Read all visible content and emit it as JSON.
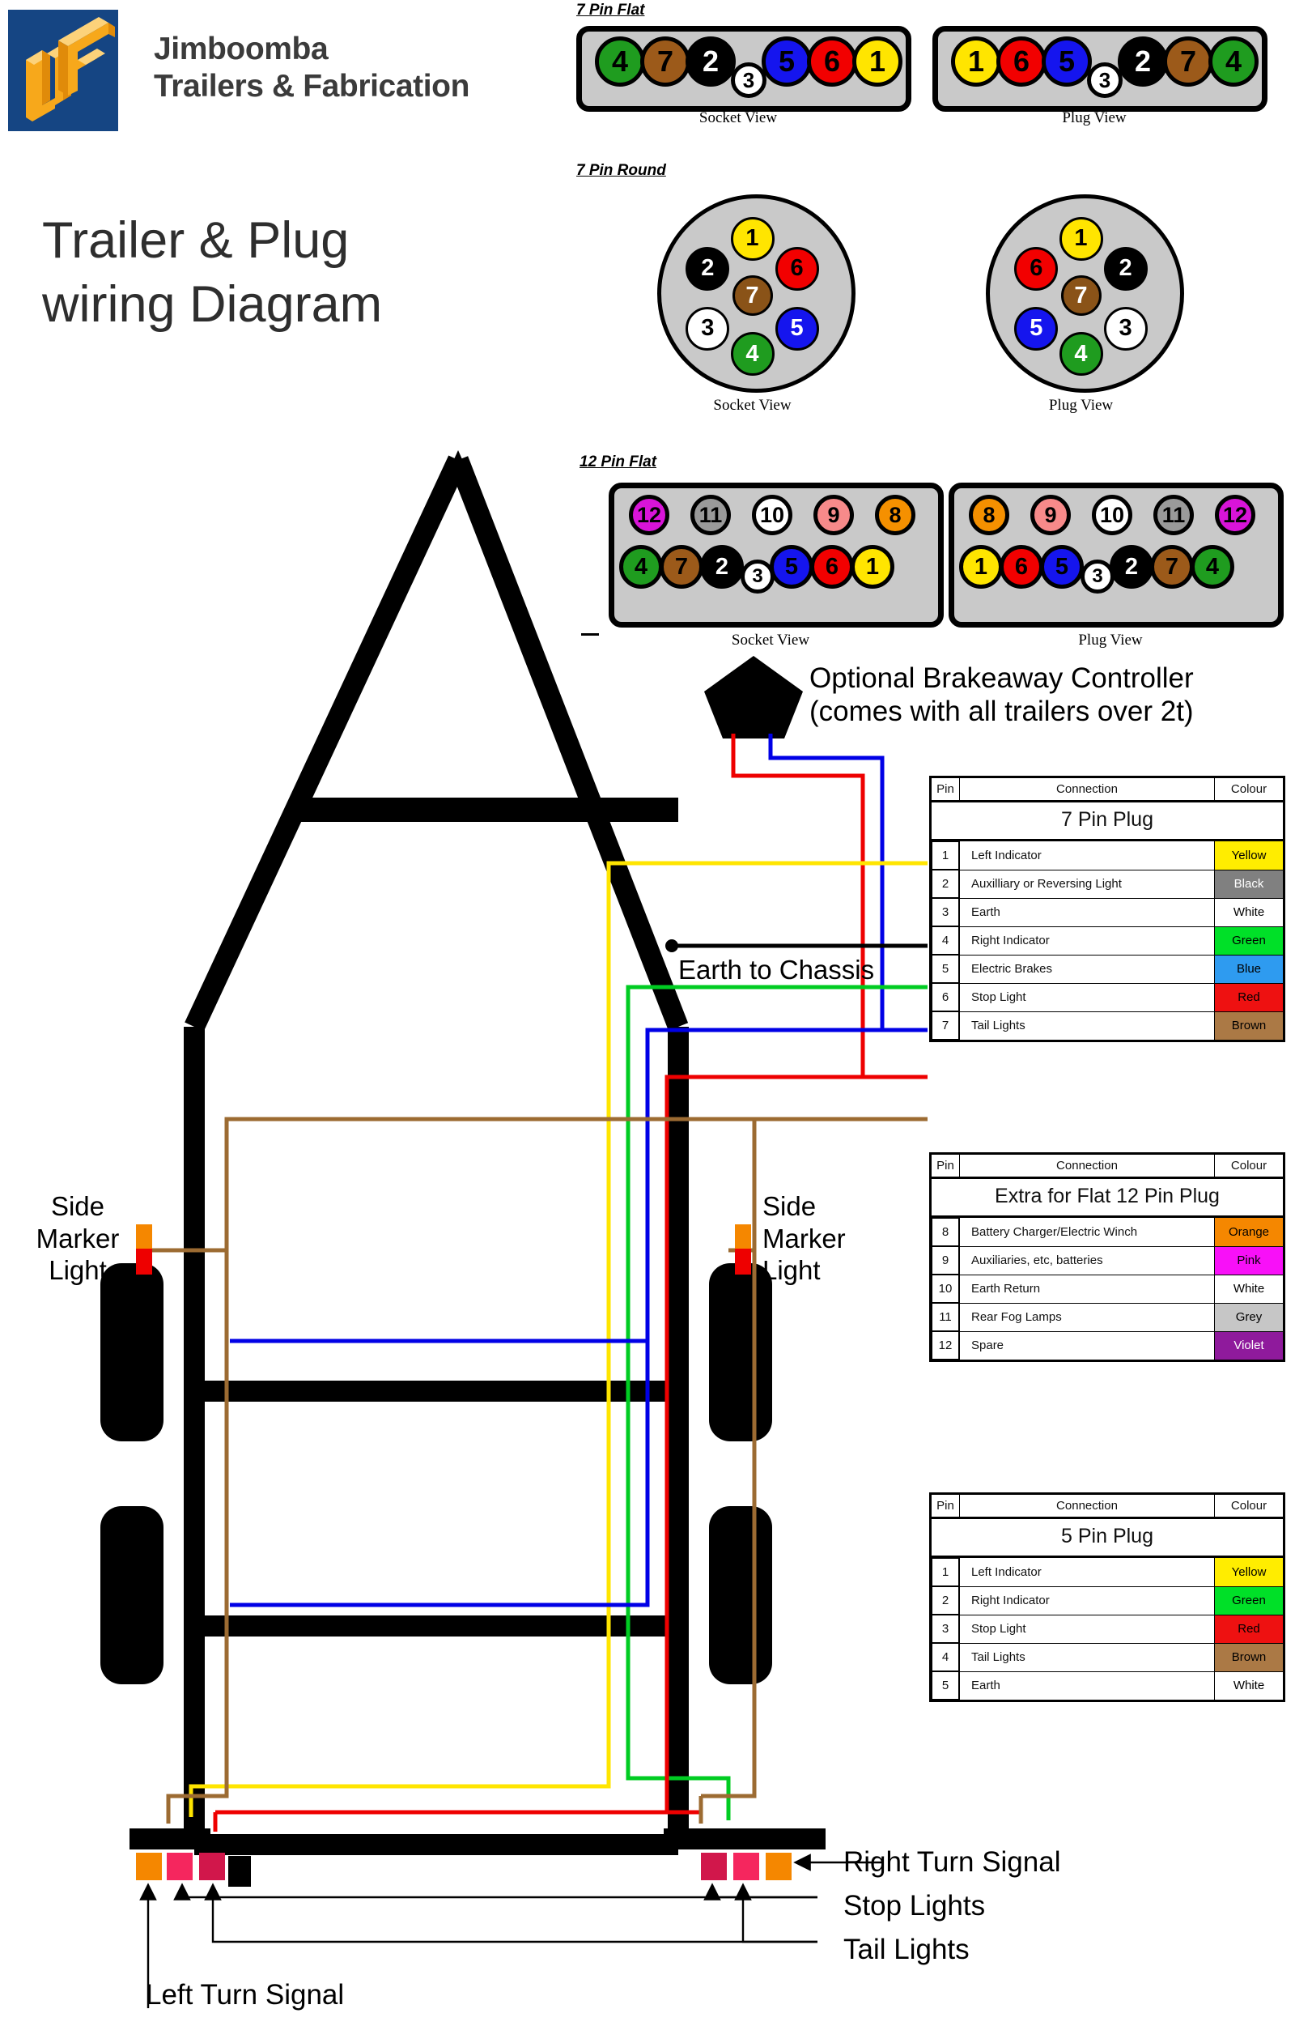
{
  "brand": {
    "name_line1": "Jimboomba",
    "name_line2": "Trailers & Fabrication",
    "logo_text": "JTF",
    "logo_bg": "#154583",
    "logo_fg": "#f5a623"
  },
  "page_title_line1": "Trailer & Plug",
  "page_title_line2": "wiring Diagram",
  "connectors": [
    {
      "heading": "7 Pin Flat",
      "type": "flat7",
      "socket": {
        "view_label": "Socket View",
        "pins": [
          {
            "n": "4",
            "color": "#1f9c1f",
            "text": "#000"
          },
          {
            "n": "7",
            "color": "#9c5a1a",
            "text": "#000"
          },
          {
            "n": "2",
            "color": "#000000",
            "text": "#ffffff"
          },
          {
            "n": "3",
            "color": "#ffffff",
            "text": "#000000",
            "low": true
          },
          {
            "n": "5",
            "color": "#1515ee",
            "text": "#000000"
          },
          {
            "n": "6",
            "color": "#f20000",
            "text": "#000000"
          },
          {
            "n": "1",
            "color": "#ffe500",
            "text": "#000000"
          }
        ]
      },
      "plug": {
        "view_label": "Plug View",
        "pins": [
          {
            "n": "1",
            "color": "#ffe500",
            "text": "#000000"
          },
          {
            "n": "6",
            "color": "#f20000",
            "text": "#000000"
          },
          {
            "n": "5",
            "color": "#1515ee",
            "text": "#000000"
          },
          {
            "n": "3",
            "color": "#ffffff",
            "text": "#000000",
            "low": true
          },
          {
            "n": "2",
            "color": "#000000",
            "text": "#ffffff"
          },
          {
            "n": "7",
            "color": "#9c5a1a",
            "text": "#000000"
          },
          {
            "n": "4",
            "color": "#1f9c1f",
            "text": "#000000"
          }
        ]
      }
    },
    {
      "heading": "7 Pin Round",
      "type": "round7",
      "socket": {
        "view_label": "Socket View",
        "pins": [
          {
            "n": "1",
            "color": "#ffe500",
            "text": "#000000",
            "pos": "top"
          },
          {
            "n": "2",
            "color": "#000000",
            "text": "#ffffff",
            "pos": "upper-left"
          },
          {
            "n": "6",
            "color": "#f20000",
            "text": "#000000",
            "pos": "upper-right"
          },
          {
            "n": "7",
            "color": "#8a5318",
            "text": "#ffffff",
            "pos": "center"
          },
          {
            "n": "3",
            "color": "#ffffff",
            "text": "#000000",
            "pos": "lower-left"
          },
          {
            "n": "5",
            "color": "#1515ee",
            "text": "#ffffff",
            "pos": "lower-right"
          },
          {
            "n": "4",
            "color": "#1f9c1f",
            "text": "#ffffff",
            "pos": "bottom"
          }
        ]
      },
      "plug": {
        "view_label": "Plug View",
        "pins": [
          {
            "n": "1",
            "color": "#ffe500",
            "text": "#000000",
            "pos": "top"
          },
          {
            "n": "2",
            "color": "#000000",
            "text": "#ffffff",
            "pos": "upper-right"
          },
          {
            "n": "6",
            "color": "#f20000",
            "text": "#000000",
            "pos": "upper-left"
          },
          {
            "n": "7",
            "color": "#8a5318",
            "text": "#ffffff",
            "pos": "center"
          },
          {
            "n": "3",
            "color": "#ffffff",
            "text": "#000000",
            "pos": "lower-right"
          },
          {
            "n": "5",
            "color": "#1515ee",
            "text": "#ffffff",
            "pos": "lower-left"
          },
          {
            "n": "4",
            "color": "#1f9c1f",
            "text": "#ffffff",
            "pos": "bottom"
          }
        ]
      }
    },
    {
      "heading": "12 Pin Flat",
      "type": "flat12",
      "socket": {
        "view_label": "Socket View",
        "top_row": [
          {
            "n": "12",
            "color": "#d814d8",
            "text": "#000000"
          },
          {
            "n": "11",
            "color": "#9a9a9a",
            "text": "#000000"
          },
          {
            "n": "10",
            "color": "#ffffff",
            "text": "#000000"
          },
          {
            "n": "9",
            "color": "#f78a8a",
            "text": "#000000"
          },
          {
            "n": "8",
            "color": "#f59000",
            "text": "#000000"
          }
        ],
        "bottom_row": [
          {
            "n": "4",
            "color": "#1f9c1f",
            "text": "#000000"
          },
          {
            "n": "7",
            "color": "#9c5a1a",
            "text": "#000000"
          },
          {
            "n": "2",
            "color": "#000000",
            "text": "#ffffff"
          },
          {
            "n": "3",
            "color": "#ffffff",
            "text": "#000000",
            "low": true
          },
          {
            "n": "5",
            "color": "#1515ee",
            "text": "#000000"
          },
          {
            "n": "6",
            "color": "#f20000",
            "text": "#000000"
          },
          {
            "n": "1",
            "color": "#ffe500",
            "text": "#000000"
          }
        ]
      },
      "plug": {
        "view_label": "Plug View",
        "top_row": [
          {
            "n": "8",
            "color": "#f59000",
            "text": "#000000"
          },
          {
            "n": "9",
            "color": "#f78a8a",
            "text": "#000000"
          },
          {
            "n": "10",
            "color": "#ffffff",
            "text": "#000000"
          },
          {
            "n": "11",
            "color": "#9a9a9a",
            "text": "#000000"
          },
          {
            "n": "12",
            "color": "#d814d8",
            "text": "#000000"
          }
        ],
        "bottom_row": [
          {
            "n": "1",
            "color": "#ffe500",
            "text": "#000000"
          },
          {
            "n": "6",
            "color": "#f20000",
            "text": "#000000"
          },
          {
            "n": "5",
            "color": "#1515ee",
            "text": "#000000"
          },
          {
            "n": "3",
            "color": "#ffffff",
            "text": "#000000",
            "low": true
          },
          {
            "n": "2",
            "color": "#000000",
            "text": "#ffffff"
          },
          {
            "n": "7",
            "color": "#9c5a1a",
            "text": "#000000"
          },
          {
            "n": "4",
            "color": "#1f9c1f",
            "text": "#000000"
          }
        ]
      }
    }
  ],
  "annotations": {
    "brakeaway_line1": "Optional Brakeaway Controller",
    "brakeaway_line2": "(comes with all trailers over 2t)",
    "earth_to_chassis": "Earth to Chassis",
    "side_marker_left": "Side\nMarker\nLight",
    "side_marker_left_l1": "Side",
    "side_marker_left_l2": "Marker",
    "side_marker_left_l3": "Light",
    "side_marker_right_l1": "Side",
    "side_marker_right_l2": "Marker",
    "side_marker_right_l3": "Light",
    "right_turn_signal": "Right Turn Signal",
    "stop_lights": "Stop Lights",
    "tail_lights": "Tail Lights",
    "left_turn_signal": "Left Turn Signal"
  },
  "tables": [
    {
      "title": "7 Pin Plug",
      "headers": [
        "Pin",
        "Connection",
        "Colour"
      ],
      "rows": [
        {
          "pin": "1",
          "connection": "Left Indicator",
          "colour": "Yellow",
          "swatch": "#ffed00",
          "fg": "#000000"
        },
        {
          "pin": "2",
          "connection": "Auxilliary or Reversing Light",
          "colour": "Black",
          "swatch": "#808080",
          "fg": "#ffffff"
        },
        {
          "pin": "3",
          "connection": "Earth",
          "colour": "White",
          "swatch": "#ffffff",
          "fg": "#000000"
        },
        {
          "pin": "4",
          "connection": "Right Indicator",
          "colour": "Green",
          "swatch": "#00e028",
          "fg": "#000000"
        },
        {
          "pin": "5",
          "connection": "Electric Brakes",
          "colour": "Blue",
          "swatch": "#2e9bf0",
          "fg": "#000000"
        },
        {
          "pin": "6",
          "connection": "Stop Light",
          "colour": "Red",
          "swatch": "#ee1111",
          "fg": "#000000"
        },
        {
          "pin": "7",
          "connection": "Tail Lights",
          "colour": "Brown",
          "swatch": "#ab7945",
          "fg": "#000000"
        }
      ]
    },
    {
      "title": "Extra for Flat 12 Pin Plug",
      "headers": [
        "Pin",
        "Connection",
        "Colour"
      ],
      "rows": [
        {
          "pin": "8",
          "connection": "Battery Charger/Electric Winch",
          "colour": "Orange",
          "swatch": "#f58700",
          "fg": "#000000"
        },
        {
          "pin": "9",
          "connection": "Auxiliaries, etc, batteries",
          "colour": "Pink",
          "swatch": "#f810f8",
          "fg": "#000000"
        },
        {
          "pin": "10",
          "connection": "Earth Return",
          "colour": "White",
          "swatch": "#ffffff",
          "fg": "#000000"
        },
        {
          "pin": "11",
          "connection": "Rear Fog Lamps",
          "colour": "Grey",
          "swatch": "#c6c6c6",
          "fg": "#000000"
        },
        {
          "pin": "12",
          "connection": "Spare",
          "colour": "Violet",
          "swatch": "#8f1a9c",
          "fg": "#ffffff"
        }
      ]
    },
    {
      "title": "5 Pin  Plug",
      "headers": [
        "Pin",
        "Connection",
        "Colour"
      ],
      "rows": [
        {
          "pin": "1",
          "connection": "Left Indicator",
          "colour": "Yellow",
          "swatch": "#ffed00",
          "fg": "#000000"
        },
        {
          "pin": "2",
          "connection": "Right Indicator",
          "colour": "Green",
          "swatch": "#00e028",
          "fg": "#000000"
        },
        {
          "pin": "3",
          "connection": "Stop Light",
          "colour": "Red",
          "swatch": "#ee1111",
          "fg": "#000000"
        },
        {
          "pin": "4",
          "connection": "Tail Lights",
          "colour": "Brown",
          "swatch": "#ab7945",
          "fg": "#000000"
        },
        {
          "pin": "5",
          "connection": "Earth",
          "colour": "White",
          "swatch": "#ffffff",
          "fg": "#000000"
        }
      ]
    }
  ],
  "wire_colors": {
    "yellow": "#ffe500",
    "green": "#00cc22",
    "blue": "#0000e6",
    "red": "#ee0000",
    "brown": "#9c6b32",
    "black": "#000000",
    "white": "#ffffff",
    "orange": "#f58700",
    "crimson": "#d1174b",
    "pink_red": "#f5265e"
  }
}
